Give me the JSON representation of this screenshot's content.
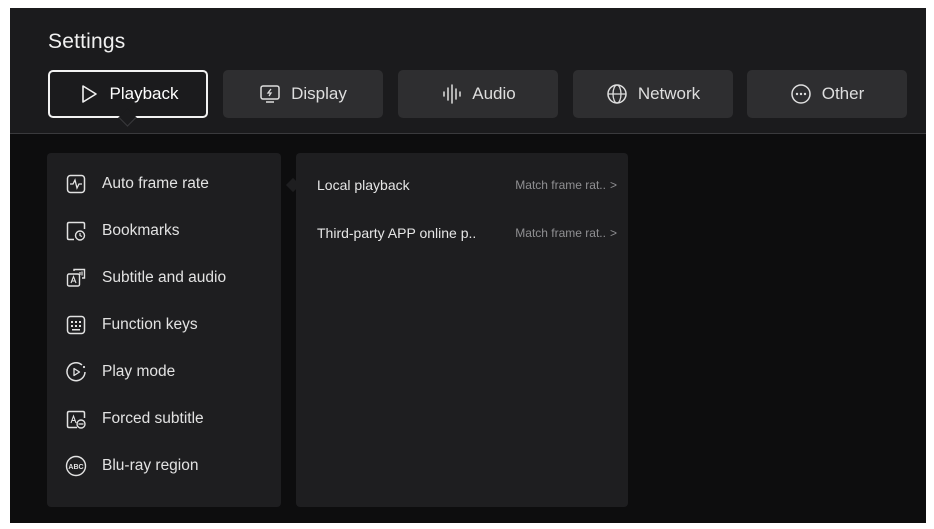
{
  "header": {
    "title": "Settings"
  },
  "tabs": [
    {
      "label": "Playback",
      "icon": "play-icon",
      "active": true
    },
    {
      "label": "Display",
      "icon": "display-icon",
      "active": false
    },
    {
      "label": "Audio",
      "icon": "audio-wave-icon",
      "active": false
    },
    {
      "label": "Network",
      "icon": "globe-icon",
      "active": false
    },
    {
      "label": "Other",
      "icon": "more-icon",
      "active": false
    }
  ],
  "menu": {
    "items": [
      {
        "label": "Auto frame rate",
        "icon": "frame-rate-icon"
      },
      {
        "label": "Bookmarks",
        "icon": "bookmark-clock-icon"
      },
      {
        "label": "Subtitle and audio",
        "icon": "subtitle-audio-icon"
      },
      {
        "label": "Function keys",
        "icon": "keyboard-icon"
      },
      {
        "label": "Play mode",
        "icon": "play-mode-icon"
      },
      {
        "label": "Forced subtitle",
        "icon": "forced-subtitle-icon"
      },
      {
        "label": "Blu-ray region",
        "icon": "bluray-region-icon"
      }
    ],
    "badge_text": "ABC"
  },
  "detail": {
    "rows": [
      {
        "label": "Local playback",
        "value": "Match frame rat..",
        "chevron": ">"
      },
      {
        "label": "Third-party APP online p..",
        "value": "Match frame rat..",
        "chevron": ">"
      }
    ]
  },
  "colors": {
    "background": "#0d0d0e",
    "panel": "#1e1e20",
    "tab": "#2e2e30",
    "text": "#e6e6e6",
    "muted": "#8f8f92"
  }
}
